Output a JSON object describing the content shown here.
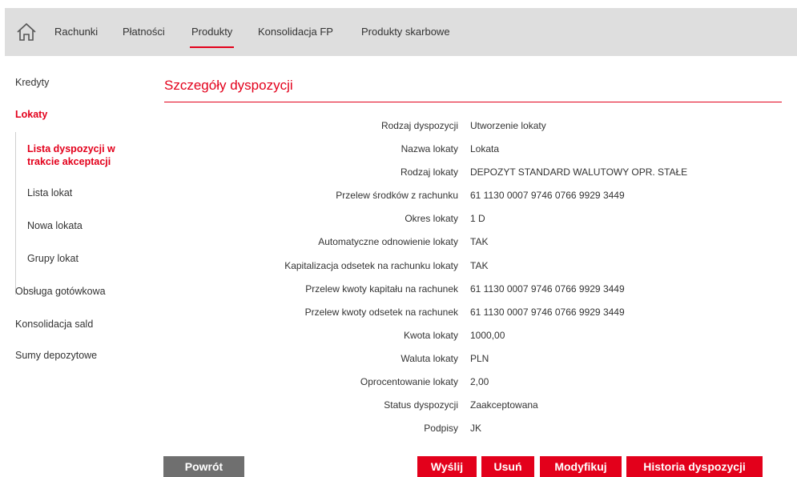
{
  "topnav": {
    "home_icon": "home-icon",
    "items": [
      {
        "label": "Rachunki"
      },
      {
        "label": "Płatności"
      },
      {
        "label": "Produkty",
        "active": true
      },
      {
        "label": "Konsolidacja FP"
      },
      {
        "label": "Produkty skarbowe"
      }
    ]
  },
  "sidebar": {
    "items": [
      {
        "label": "Kredyty"
      },
      {
        "label": "Lokaty",
        "active": true
      },
      {
        "label": "Obsługa gotówkowa"
      },
      {
        "label": "Konsolidacja sald"
      },
      {
        "label": "Sumy depozytowe"
      }
    ],
    "sub_items": [
      {
        "label": "Lista dyspozycji w trakcie akceptacji",
        "active": true
      },
      {
        "label": "Lista lokat"
      },
      {
        "label": "Nowa lokata"
      },
      {
        "label": "Grupy lokat"
      }
    ]
  },
  "main": {
    "title": "Szczegóły dyspozycji",
    "details": [
      {
        "label": "Rodzaj dyspozycji",
        "value": "Utworzenie lokaty"
      },
      {
        "label": "Nazwa lokaty",
        "value": "Lokata"
      },
      {
        "label": "Rodzaj lokaty",
        "value": "DEPOZYT STANDARD WALUTOWY OPR. STAŁE"
      },
      {
        "label": "Przelew środków z rachunku",
        "value": "61 1130 0007 9746 0766 9929 3449"
      },
      {
        "label": "Okres lokaty",
        "value": "1 D"
      },
      {
        "label": "Automatyczne odnowienie lokaty",
        "value": "TAK"
      },
      {
        "label": "Kapitalizacja odsetek na rachunku lokaty",
        "value": "TAK"
      },
      {
        "label": "Przelew kwoty kapitału na rachunek",
        "value": "61 1130 0007 9746 0766 9929 3449"
      },
      {
        "label": "Przelew kwoty odsetek na rachunek",
        "value": "61 1130 0007 9746 0766 9929 3449"
      },
      {
        "label": "Kwota lokaty",
        "value": "1000,00"
      },
      {
        "label": "Waluta lokaty",
        "value": "PLN"
      },
      {
        "label": "Oprocentowanie lokaty",
        "value": "2,00"
      },
      {
        "label": "Status dyspozycji",
        "value": "Zaakceptowana"
      },
      {
        "label": "Podpisy",
        "value": "JK"
      }
    ]
  },
  "buttons": {
    "back": "Powrót",
    "send": "Wyślij",
    "delete": "Usuń",
    "modify": "Modyfikuj",
    "history": "Historia dyspozycji"
  },
  "colors": {
    "accent": "#e3001b",
    "nav_bg": "#dedede",
    "button_grey": "#6f6f6f"
  }
}
